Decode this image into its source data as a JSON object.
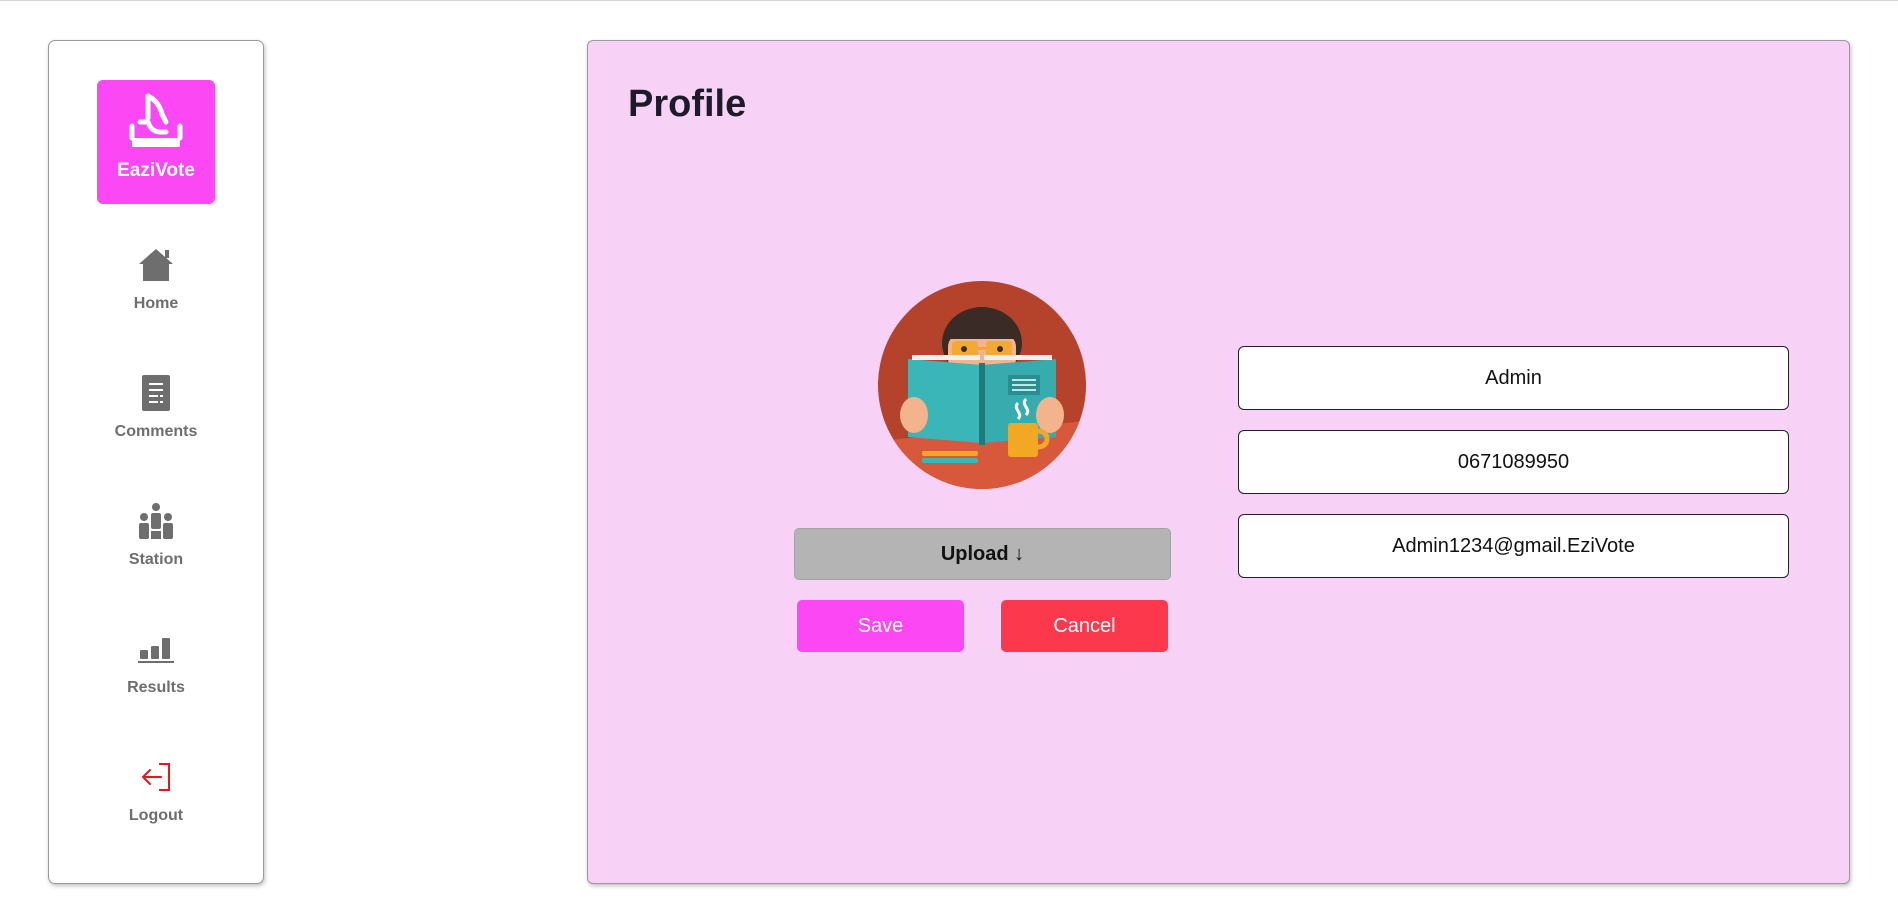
{
  "brand": {
    "name": "EaziVote",
    "accent": "#fb48f4"
  },
  "sidebar": {
    "items": [
      {
        "label": "Home",
        "icon": "home-icon"
      },
      {
        "label": "Comments",
        "icon": "document-icon"
      },
      {
        "label": "Station",
        "icon": "people-icon"
      },
      {
        "label": "Results",
        "icon": "bar-chart-icon"
      },
      {
        "label": "Logout",
        "icon": "logout-icon",
        "color": "#e8141e"
      }
    ]
  },
  "main": {
    "title": "Profile",
    "background": "#f7d2f6",
    "upload_label": "Upload ↓",
    "save_label": "Save",
    "cancel_label": "Cancel",
    "fields": {
      "name": "Admin",
      "phone": "0671089950",
      "email": "Admin1234@gmail.EziVote"
    }
  }
}
